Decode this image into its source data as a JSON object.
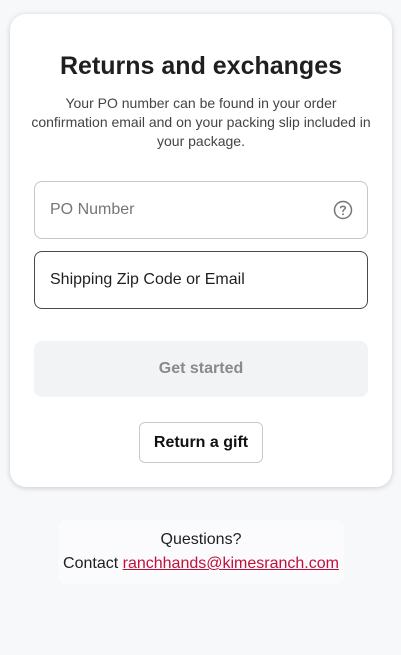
{
  "card": {
    "title": "Returns and exchanges",
    "subtitle": "Your PO number can be found in your order confirmation email and on your packing slip included in your package.",
    "po_field": {
      "placeholder": "PO Number",
      "value": ""
    },
    "zip_field": {
      "placeholder": "Shipping Zip Code or Email",
      "value": ""
    },
    "get_started_label": "Get started",
    "return_gift_label": "Return a gift"
  },
  "contact": {
    "questions": "Questions?",
    "contact_prefix": "Contact",
    "email": "ranchhands@kimesranch.com"
  },
  "colors": {
    "link": "#c0103a",
    "disabled_button_bg": "#f2f3f5",
    "disabled_button_text": "#8a8a8a"
  },
  "icons": {
    "po_help": "question-circle-icon"
  }
}
